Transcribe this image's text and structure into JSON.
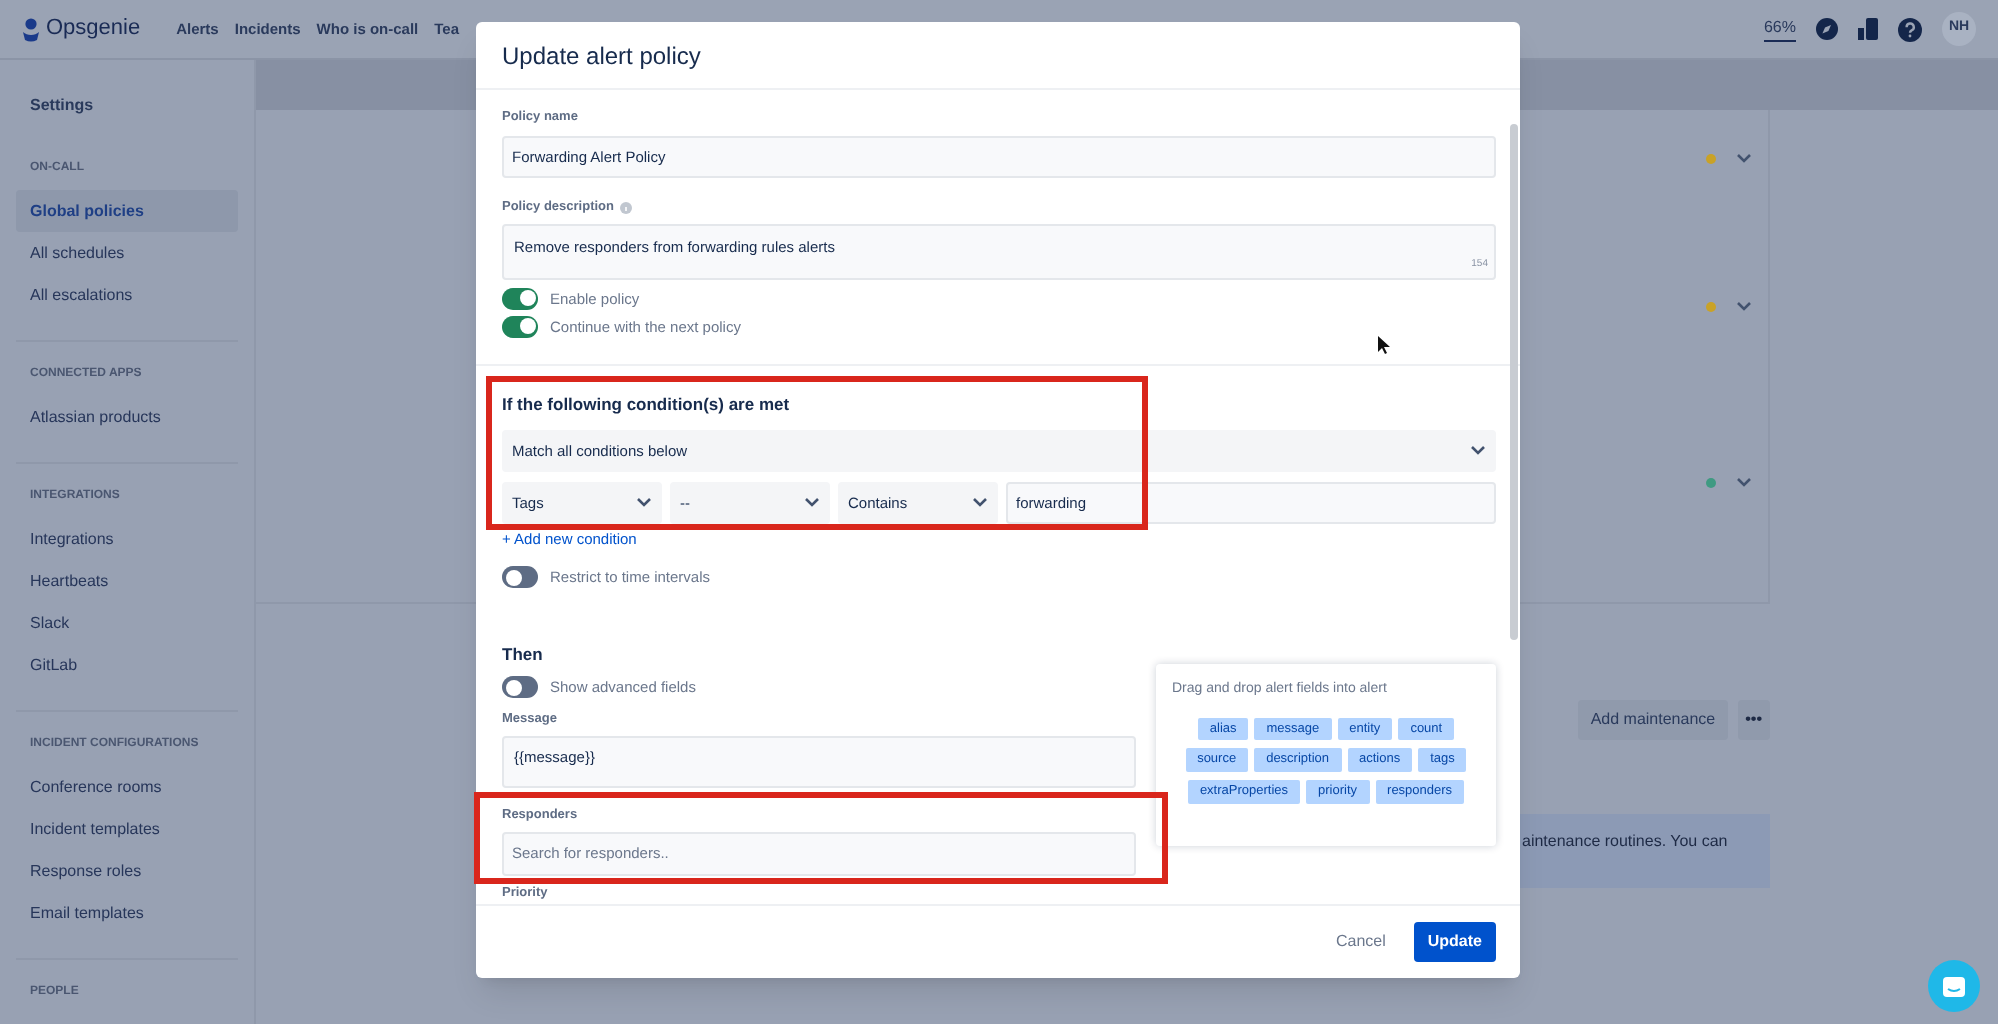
{
  "nav": {
    "logo": "Opsgenie",
    "links": [
      "Alerts",
      "Incidents",
      "Who is on-call",
      "Tea"
    ],
    "zoom": "66%",
    "avatar": "NH"
  },
  "sidebar": {
    "title": "Settings",
    "sections": [
      {
        "heading": "ON-CALL",
        "items": [
          {
            "label": "Global policies",
            "selected": true
          },
          {
            "label": "All schedules",
            "selected": false
          },
          {
            "label": "All escalations",
            "selected": false
          }
        ]
      },
      {
        "heading": "CONNECTED APPS",
        "items": [
          {
            "label": "Atlassian products",
            "selected": false
          }
        ]
      },
      {
        "heading": "INTEGRATIONS",
        "items": [
          {
            "label": "Integrations",
            "selected": false
          },
          {
            "label": "Heartbeats",
            "selected": false
          },
          {
            "label": "Slack",
            "selected": false
          },
          {
            "label": "GitLab",
            "selected": false
          }
        ]
      },
      {
        "heading": "INCIDENT CONFIGURATIONS",
        "items": [
          {
            "label": "Conference rooms",
            "selected": false
          },
          {
            "label": "Incident templates",
            "selected": false
          },
          {
            "label": "Response roles",
            "selected": false
          },
          {
            "label": "Email templates",
            "selected": false
          }
        ]
      },
      {
        "heading": "PEOPLE"
      }
    ]
  },
  "background": {
    "policy_rows": [
      {
        "color": "#c9a227"
      },
      {
        "color": "#c9a227"
      },
      {
        "color": "#3f9a82"
      }
    ],
    "add_maintenance": "Add maintenance",
    "more": "•••",
    "banner_text": "aintenance routines. You can"
  },
  "modal": {
    "title": "Update alert policy",
    "policy_name": {
      "label": "Policy name",
      "value": "Forwarding Alert Policy"
    },
    "policy_description": {
      "label": "Policy description",
      "value": "Remove responders from forwarding rules alerts",
      "counter": "154"
    },
    "toggles": [
      {
        "label": "Enable policy",
        "on": true
      },
      {
        "label": "Continue with the next policy",
        "on": true
      }
    ],
    "conditions": {
      "heading": "If the following condition(s) are met",
      "match": "Match all conditions below",
      "row": {
        "field": "Tags",
        "operator_prefix": "--",
        "operator": "Contains",
        "value": "forwarding"
      },
      "add": "+ Add new condition"
    },
    "restrict": {
      "label": "Restrict to time intervals",
      "on": false
    },
    "then": {
      "heading": "Then",
      "advanced": {
        "label": "Show advanced fields",
        "on": false
      },
      "message": {
        "label": "Message",
        "value": "{{message}}"
      },
      "responders": {
        "label": "Responders",
        "placeholder": "Search for responders.."
      },
      "priority": {
        "label": "Priority"
      }
    },
    "alert_fields": {
      "title": "Drag and drop alert fields into alert",
      "chips": [
        "alias",
        "message",
        "entity",
        "count",
        "source",
        "description",
        "actions",
        "tags",
        "extraProperties",
        "priority",
        "responders"
      ]
    },
    "footer": {
      "cancel": "Cancel",
      "update": "Update"
    }
  }
}
